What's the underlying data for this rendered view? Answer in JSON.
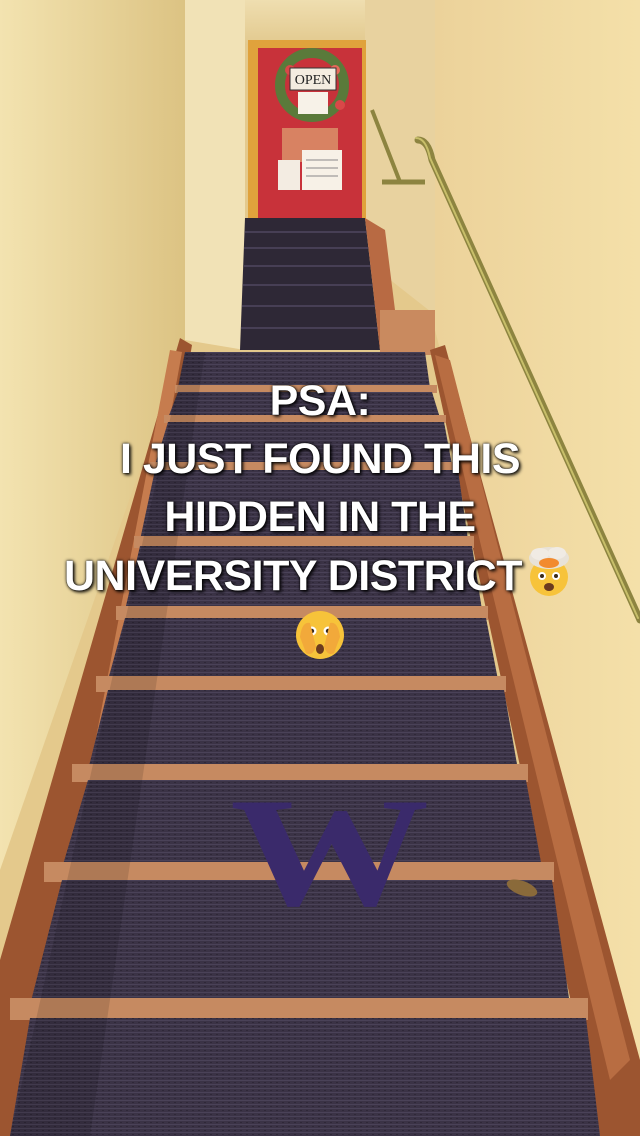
{
  "overlay": {
    "line1": "PSA:",
    "line2": "I JUST FOUND THIS",
    "line3": "HIDDEN IN THE",
    "line4": "UNIVERSITY DISTRICT",
    "emoji_after_line4": "exploding-head-emoji",
    "emoji_line5": "face-with-open-eyes-and-hand-over-mouth-emoji"
  },
  "door": {
    "sign_text": "OPEN"
  },
  "stairs": {
    "logo_letter": "W"
  },
  "colors": {
    "wall": "#e9cf93",
    "door": "#c8323a",
    "carpet": "#3b3346",
    "stair_edge": "#c8885e",
    "logo": "#3a2a6b"
  }
}
